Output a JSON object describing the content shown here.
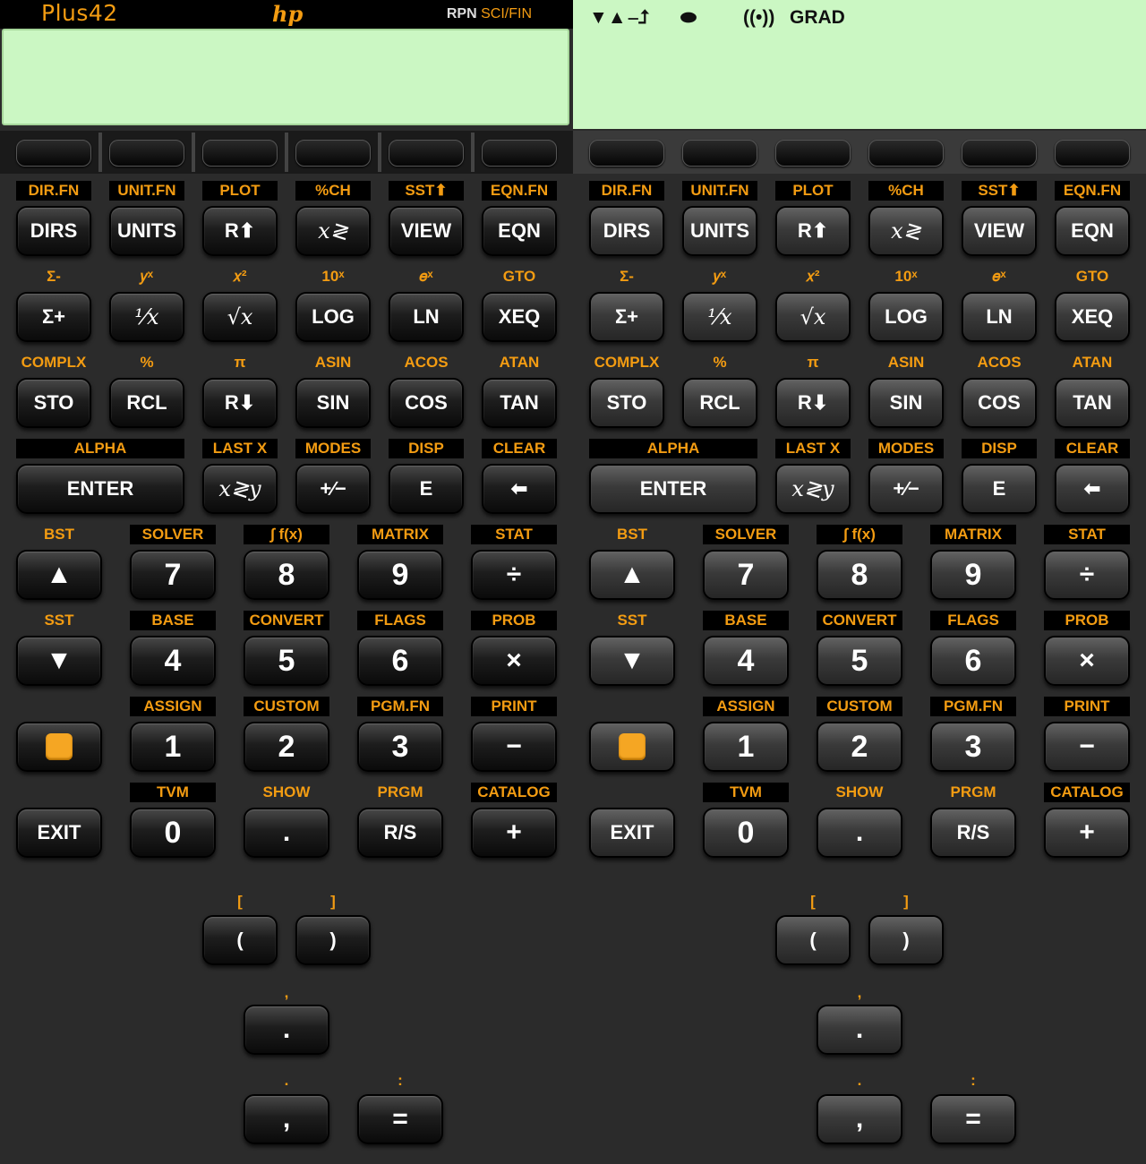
{
  "header": {
    "app_name": "Plus42",
    "logo": "hp",
    "mode": "RPN",
    "mode_sub": "SCI/FIN"
  },
  "annunciators": {
    "ann1": "▼▲",
    "ann2": "⎯⮥",
    "ann3": "⬬",
    "ann4": "((•))",
    "ann5": "GRAD"
  },
  "colors": {
    "accent": "#f39c12",
    "lcd": "#cbf7c3",
    "key": "#1d1d1d"
  },
  "rows": {
    "r1": {
      "shift": [
        "DIR.FN",
        "UNIT.FN",
        "PLOT",
        "%CH",
        "SST⬆",
        "EQN.FN"
      ],
      "keys": [
        "DIRS",
        "UNITS",
        "R⬆",
        "𝑥≷",
        "VIEW",
        "EQN"
      ]
    },
    "r2": {
      "shift": [
        "Σ-",
        "𝑦ˣ",
        "𝑥²",
        "10ˣ",
        "𝑒ˣ",
        "GTO"
      ],
      "keys": [
        "Σ+",
        "¹⁄𝑥",
        "√𝑥",
        "LOG",
        "LN",
        "XEQ"
      ]
    },
    "r3": {
      "shift": [
        "COMPLX",
        "%",
        "π",
        "ASIN",
        "ACOS",
        "ATAN"
      ],
      "keys": [
        "STO",
        "RCL",
        "R⬇",
        "SIN",
        "COS",
        "TAN"
      ]
    },
    "r4": {
      "shift": [
        "ALPHA",
        "LAST X",
        "MODES",
        "DISP",
        "CLEAR"
      ],
      "keys": [
        "ENTER",
        "𝑥≷𝑦",
        "+∕−",
        "E",
        "⬅"
      ]
    },
    "r5": {
      "shift": [
        "BST",
        "SOLVER",
        "∫ f(x)",
        "MATRIX",
        "STAT"
      ],
      "keys": [
        "▲",
        "7",
        "8",
        "9",
        "÷"
      ]
    },
    "r6": {
      "shift": [
        "SST",
        "BASE",
        "CONVERT",
        "FLAGS",
        "PROB"
      ],
      "keys": [
        "▼",
        "4",
        "5",
        "6",
        "×"
      ]
    },
    "r7": {
      "shift": [
        "",
        "ASSIGN",
        "CUSTOM",
        "PGM.FN",
        "PRINT"
      ],
      "keys": [
        "",
        "1",
        "2",
        "3",
        "−"
      ]
    },
    "r8": {
      "shift": [
        "",
        "TVM",
        "SHOW",
        "PRGM",
        "CATALOG"
      ],
      "keys": [
        "EXIT",
        "0",
        ".",
        "R/S",
        "+"
      ]
    },
    "extra": {
      "bracket_left": "[",
      "bracket_right": "]",
      "paren_left": "(",
      "paren_right": ")",
      "comma_label": ",",
      "dot": ".",
      "dot_label": ".",
      "colon_label": ":",
      "comma": ",",
      "equals": "="
    }
  }
}
